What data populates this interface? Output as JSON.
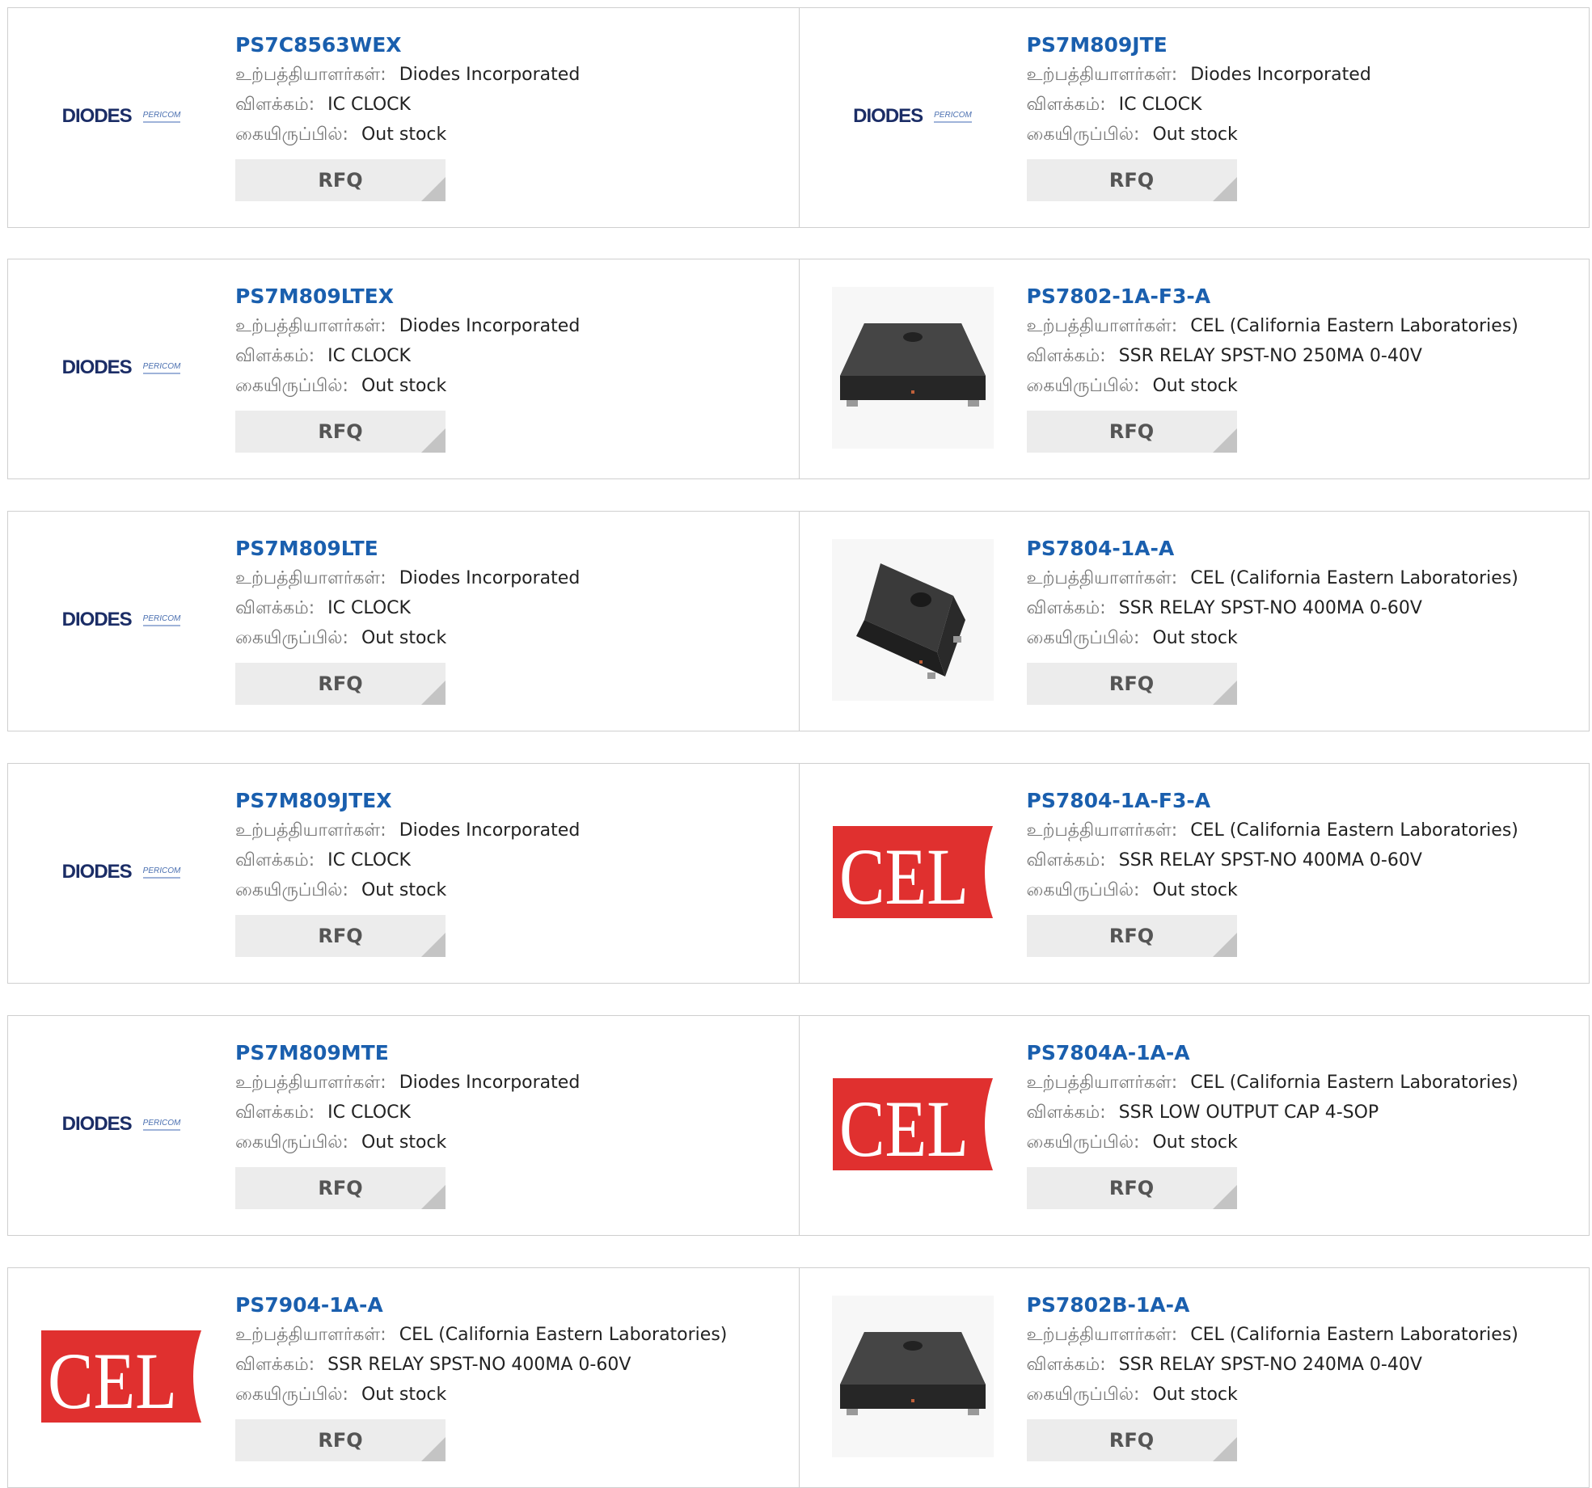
{
  "labels": {
    "manufacturer": "உற்பத்தியாளர்கள்:",
    "description": "விளக்கம்:",
    "stock": "கையிருப்பில்:",
    "rfq": "RFQ"
  },
  "products": [
    {
      "part": "PS7C8563WEX",
      "manufacturer": "Diodes Incorporated",
      "description": "IC CLOCK",
      "stock": "Out stock",
      "image": "diodes-pericom-logo"
    },
    {
      "part": "PS7M809JTE",
      "manufacturer": "Diodes Incorporated",
      "description": "IC CLOCK",
      "stock": "Out stock",
      "image": "diodes-pericom-logo"
    },
    {
      "part": "PS7M809LTEX",
      "manufacturer": "Diodes Incorporated",
      "description": "IC CLOCK",
      "stock": "Out stock",
      "image": "diodes-pericom-logo"
    },
    {
      "part": "PS7802-1A-F3-A",
      "manufacturer": "CEL (California Eastern Laboratories)",
      "description": "SSR RELAY SPST-NO 250MA 0-40V",
      "stock": "Out stock",
      "image": "relay-chip-side-photo"
    },
    {
      "part": "PS7M809LTE",
      "manufacturer": "Diodes Incorporated",
      "description": "IC CLOCK",
      "stock": "Out stock",
      "image": "diodes-pericom-logo"
    },
    {
      "part": "PS7804-1A-A",
      "manufacturer": "CEL (California Eastern Laboratories)",
      "description": "SSR RELAY SPST-NO 400MA 0-60V",
      "stock": "Out stock",
      "image": "relay-chip-angled-photo"
    },
    {
      "part": "PS7M809JTEX",
      "manufacturer": "Diodes Incorporated",
      "description": "IC CLOCK",
      "stock": "Out stock",
      "image": "diodes-pericom-logo"
    },
    {
      "part": "PS7804-1A-F3-A",
      "manufacturer": "CEL (California Eastern Laboratories)",
      "description": "SSR RELAY SPST-NO 400MA 0-60V",
      "stock": "Out stock",
      "image": "cel-logo"
    },
    {
      "part": "PS7M809MTE",
      "manufacturer": "Diodes Incorporated",
      "description": "IC CLOCK",
      "stock": "Out stock",
      "image": "diodes-pericom-logo"
    },
    {
      "part": "PS7804A-1A-A",
      "manufacturer": "CEL (California Eastern Laboratories)",
      "description": "SSR LOW OUTPUT CAP 4-SOP",
      "stock": "Out stock",
      "image": "cel-logo"
    },
    {
      "part": "PS7904-1A-A",
      "manufacturer": "CEL (California Eastern Laboratories)",
      "description": "SSR RELAY SPST-NO 400MA 0-60V",
      "stock": "Out stock",
      "image": "cel-logo"
    },
    {
      "part": "PS7802B-1A-A",
      "manufacturer": "CEL (California Eastern Laboratories)",
      "description": "SSR RELAY SPST-NO 240MA 0-40V",
      "stock": "Out stock",
      "image": "relay-chip-side-photo"
    }
  ],
  "logos": {
    "diodes": {
      "word": "DIODES",
      "sub": "PERICOM"
    },
    "cel": {
      "text": "CEL",
      "color": "#e0302f"
    }
  }
}
